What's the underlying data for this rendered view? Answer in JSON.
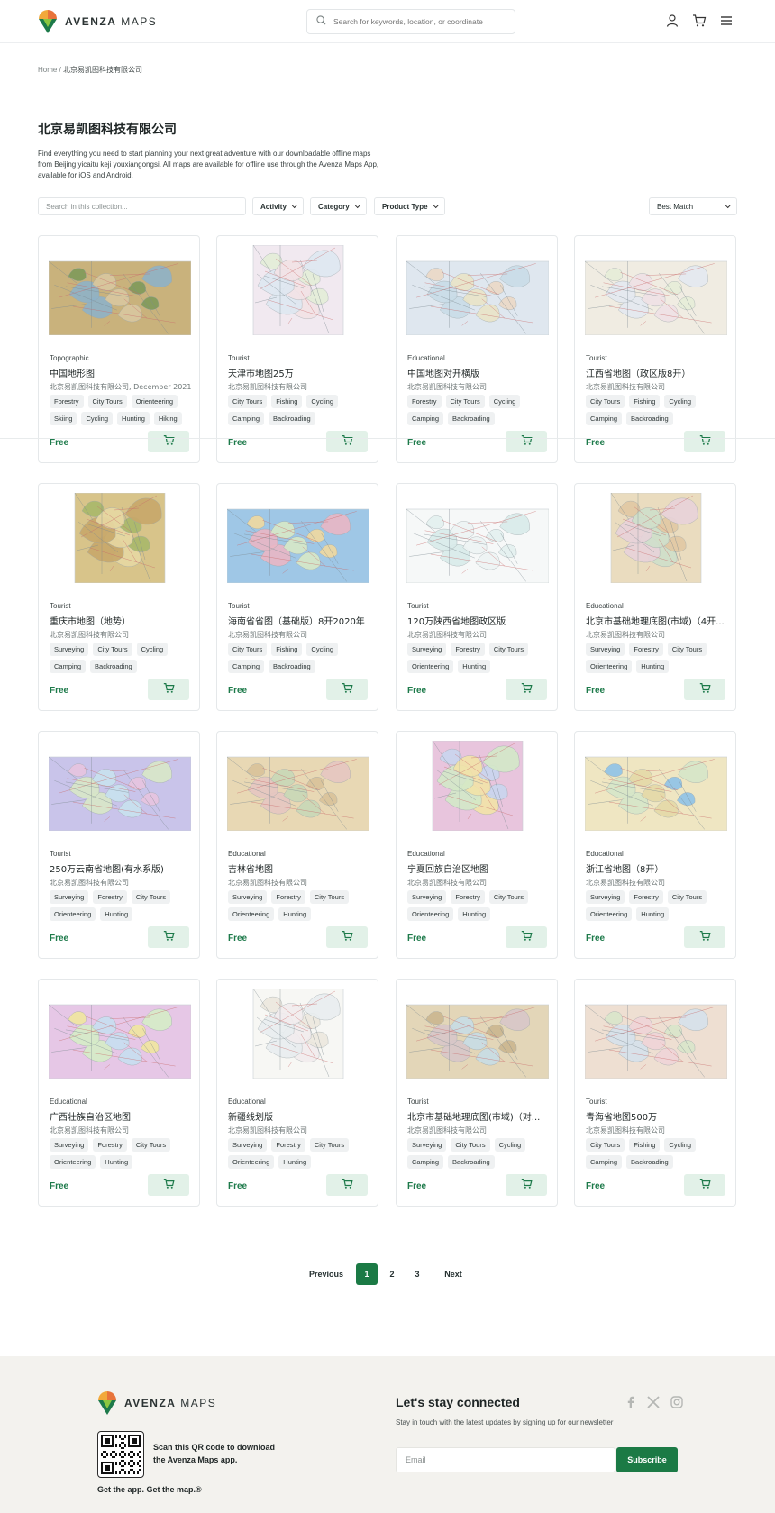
{
  "header": {
    "brand_bold": "AVENZA",
    "brand_light": "MAPS",
    "search_placeholder": "Search for keywords, location, or coordinate"
  },
  "breadcrumb": {
    "home": "Home",
    "separator": "/",
    "current": "北京易凯图科技有限公司"
  },
  "collection": {
    "title": "北京易凯图科技有限公司",
    "description": "Find everything you need to start planning your next great adventure with our downloadable offline maps from Beijing yicaitu keji youxiangongsi. All maps are available for offline use through the Avenza Maps App, available for iOS and Android."
  },
  "filters": {
    "search_placeholder": "Search in this collection...",
    "activity": "Activity",
    "category": "Category",
    "product_type": "Product Type",
    "sort": "Best Match"
  },
  "products": [
    {
      "type": "Topographic",
      "name": "中国地形图",
      "publisher": "北京易凯图科技有限公司, December 2021",
      "tags": [
        "Forestry",
        "City Tours",
        "Orienteering",
        "Skiing",
        "Cycling",
        "Hunting",
        "Hiking"
      ],
      "price": "Free",
      "palette": [
        "#c9b27c",
        "#7f9a5a",
        "#d9c8a0",
        "#8fb3c8"
      ]
    },
    {
      "type": "Tourist",
      "name": "天津市地图25万",
      "publisher": "北京易凯图科技有限公司",
      "tags": [
        "City Tours",
        "Fishing",
        "Cycling",
        "Camping",
        "Backroading"
      ],
      "price": "Free",
      "palette": [
        "#f1e9f0",
        "#e4eed8",
        "#f3e3e6",
        "#dfe8f2"
      ]
    },
    {
      "type": "Educational",
      "name": "中国地图对开横版",
      "publisher": "北京易凯图科技有限公司",
      "tags": [
        "Forestry",
        "City Tours",
        "Cycling",
        "Camping",
        "Backroading"
      ],
      "price": "Free",
      "palette": [
        "#dfe7ef",
        "#ecd9c7",
        "#e9e4c8",
        "#c9dde8"
      ]
    },
    {
      "type": "Tourist",
      "name": "江西省地图（政区版8开）",
      "publisher": "北京易凯图科技有限公司",
      "tags": [
        "City Tours",
        "Fishing",
        "Cycling",
        "Camping",
        "Backroading"
      ],
      "price": "Free",
      "palette": [
        "#f0ece2",
        "#e7eed9",
        "#efe2e6",
        "#e4e9f1"
      ]
    },
    {
      "type": "Tourist",
      "name": "重庆市地图（地势）",
      "publisher": "北京易凯图科技有限公司",
      "tags": [
        "Surveying",
        "City Tours",
        "Cycling",
        "Camping",
        "Backroading"
      ],
      "price": "Free",
      "palette": [
        "#d8c48a",
        "#a9b86a",
        "#e7d8a3",
        "#c8a86a"
      ]
    },
    {
      "type": "Tourist",
      "name": "海南省省图（基础版）8开2020年",
      "publisher": "北京易凯图科技有限公司",
      "tags": [
        "City Tours",
        "Fishing",
        "Cycling",
        "Camping",
        "Backroading"
      ],
      "price": "Free",
      "palette": [
        "#9fc7e6",
        "#f1d9a0",
        "#d8e9c8",
        "#eab7c5"
      ]
    },
    {
      "type": "Tourist",
      "name": "120万陕西省地图政区版",
      "publisher": "北京易凯图科技有限公司",
      "tags": [
        "Surveying",
        "Forestry",
        "City Tours",
        "Orienteering",
        "Hunting"
      ],
      "price": "Free",
      "palette": [
        "#f6f8f8",
        "#e4f1f0",
        "#eef4f4",
        "#d9ebea"
      ]
    },
    {
      "type": "Educational",
      "name": "北京市基础地理底图(市域)（4开...",
      "publisher": "北京易凯图科技有限公司",
      "tags": [
        "Surveying",
        "Forestry",
        "City Tours",
        "Orienteering",
        "Hunting"
      ],
      "price": "Free",
      "palette": [
        "#eadcbf",
        "#e2c9a4",
        "#cfe0cb",
        "#e8d3da"
      ]
    },
    {
      "type": "Tourist",
      "name": "250万云南省地图(有水系版)",
      "publisher": "北京易凯图科技有限公司",
      "tags": [
        "Surveying",
        "Forestry",
        "City Tours",
        "Orienteering",
        "Hunting"
      ],
      "price": "Free",
      "palette": [
        "#c9c4ea",
        "#e8c5e0",
        "#c8e2ef",
        "#d9e8c8"
      ]
    },
    {
      "type": "Educational",
      "name": "吉林省地图",
      "publisher": "北京易凯图科技有限公司",
      "tags": [
        "Surveying",
        "Forestry",
        "City Tours",
        "Orienteering",
        "Hunting"
      ],
      "price": "Free",
      "palette": [
        "#e8d8b4",
        "#d9c29a",
        "#c8d9b8",
        "#e6c7c2"
      ]
    },
    {
      "type": "Educational",
      "name": "宁夏回族自治区地图",
      "publisher": "北京易凯图科技有限公司",
      "tags": [
        "Surveying",
        "Forestry",
        "City Tours",
        "Orienteering",
        "Hunting"
      ],
      "price": "Free",
      "palette": [
        "#e8c5dd",
        "#c9d6ef",
        "#f2e3a8",
        "#d4e9c8"
      ]
    },
    {
      "type": "Educational",
      "name": "浙江省地图（8开）",
      "publisher": "北京易凯图科技有限公司",
      "tags": [
        "Surveying",
        "Forestry",
        "City Tours",
        "Orienteering",
        "Hunting"
      ],
      "price": "Free",
      "palette": [
        "#efe6c2",
        "#8fc3e8",
        "#e5d9a8",
        "#d6e7c9"
      ]
    },
    {
      "type": "Educational",
      "name": "广西壮族自治区地图",
      "publisher": "北京易凯图科技有限公司",
      "tags": [
        "Surveying",
        "Forestry",
        "City Tours",
        "Orienteering",
        "Hunting"
      ],
      "price": "Free",
      "palette": [
        "#e6c7e6",
        "#f1e7a0",
        "#c8dff0",
        "#d6edc8"
      ]
    },
    {
      "type": "Educational",
      "name": "新疆线划版",
      "publisher": "北京易凯图科技有限公司",
      "tags": [
        "Surveying",
        "Forestry",
        "City Tours",
        "Orienteering",
        "Hunting"
      ],
      "price": "Free",
      "palette": [
        "#f7f7f4",
        "#ece8de",
        "#f2ecee",
        "#e9eef0"
      ]
    },
    {
      "type": "Tourist",
      "name": "北京市基础地理底图(市域)（对...",
      "publisher": "北京易凯图科技有限公司",
      "tags": [
        "Surveying",
        "City Tours",
        "Cycling",
        "Camping",
        "Backroading"
      ],
      "price": "Free",
      "palette": [
        "#e3d6b8",
        "#cbb68f",
        "#c8dde6",
        "#d8c7c9"
      ]
    },
    {
      "type": "Tourist",
      "name": "青海省地图500万",
      "publisher": "北京易凯图科技有限公司",
      "tags": [
        "City Tours",
        "Fishing",
        "Cycling",
        "Camping",
        "Backroading"
      ],
      "price": "Free",
      "palette": [
        "#eedfd2",
        "#d9e6cb",
        "#f0d4d8",
        "#d6e2ec"
      ]
    }
  ],
  "pagination": {
    "previous": "Previous",
    "pages": [
      "1",
      "2",
      "3"
    ],
    "current": "1",
    "next": "Next"
  },
  "footer": {
    "brand_bold": "AVENZA",
    "brand_light": "MAPS",
    "qr_text": "Scan this QR code to download the Avenza Maps app.",
    "tagline": "Get the app. Get the map.®",
    "newsletter_title": "Let's stay connected",
    "newsletter_sub": "Stay in touch with the latest updates by signing up for our newsletter",
    "email_placeholder": "Email",
    "subscribe": "Subscribe"
  },
  "colors": {
    "accent": "#1b7a45",
    "price": "#1d7a4a",
    "cart_bg": "#e2f1e8",
    "footer_bg": "#f3f2ee"
  },
  "icons": [
    "search-icon",
    "user-icon",
    "cart-icon",
    "menu-icon",
    "chevron-down-icon",
    "facebook-icon",
    "x-icon",
    "instagram-icon"
  ]
}
